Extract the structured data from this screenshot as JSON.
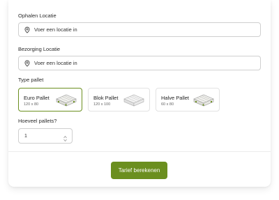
{
  "pickup": {
    "label": "Ophalen Locatie",
    "placeholder": "Voer een locatie in",
    "icon": "location-pin-icon"
  },
  "delivery": {
    "label": "Bezorging Locatie",
    "placeholder": "Voer een locatie in",
    "icon": "location-pin-icon"
  },
  "pallet_type": {
    "label": "Type pallet",
    "selected": "Euro Pallet",
    "options": [
      {
        "name": "Euro Pallet",
        "size": "120 x 80",
        "icon": "pallet-icon"
      },
      {
        "name": "Blok Pallet",
        "size": "120 x 100",
        "icon": "pallet-icon"
      },
      {
        "name": "Halve Pallet",
        "size": "60 x 80",
        "icon": "pallet-icon"
      }
    ]
  },
  "quantity": {
    "label": "Hoeveel pallets?",
    "value": "1"
  },
  "submit": {
    "label": "Tarief berekenen"
  },
  "colors": {
    "accent": "#6b8f1f",
    "border": "#cfcfcf"
  }
}
